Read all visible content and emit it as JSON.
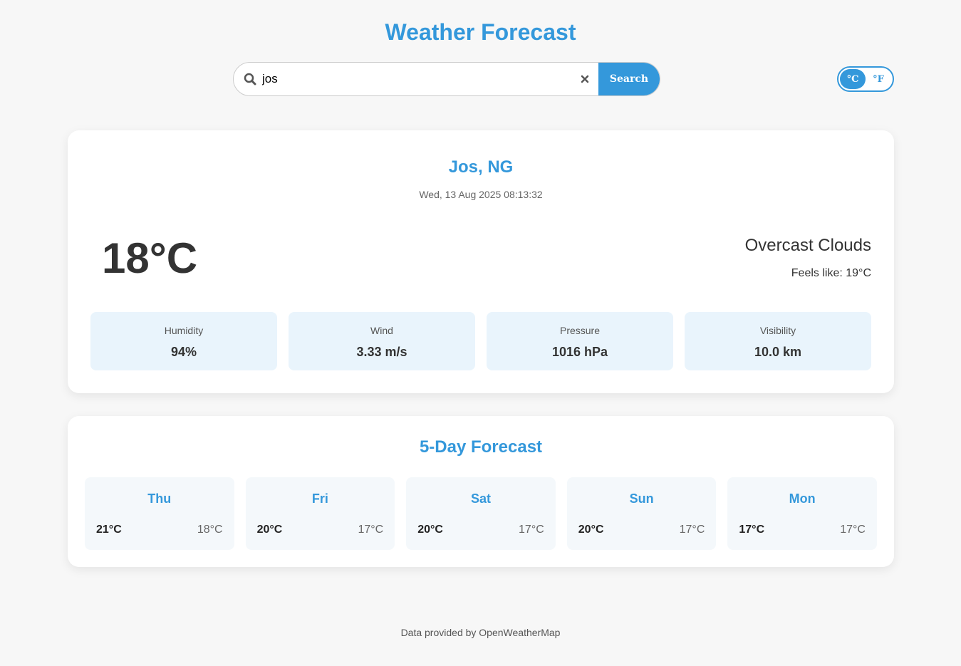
{
  "header": {
    "title": "Weather Forecast"
  },
  "search": {
    "value": "jos",
    "button_label": "Search",
    "clear_symbol": "×"
  },
  "units": {
    "celsius": "°C",
    "fahrenheit": "°F",
    "active": "celsius"
  },
  "current": {
    "location": "Jos, NG",
    "datetime": "Wed, 13 Aug 2025 08:13:32",
    "temperature": "18°C",
    "condition": "Overcast Clouds",
    "feels_like": "Feels like: 19°C",
    "stats": [
      {
        "label": "Humidity",
        "value": "94%"
      },
      {
        "label": "Wind",
        "value": "3.33 m/s"
      },
      {
        "label": "Pressure",
        "value": "1016 hPa"
      },
      {
        "label": "Visibility",
        "value": "10.0 km"
      }
    ]
  },
  "forecast": {
    "title": "5-Day Forecast",
    "days": [
      {
        "day": "Thu",
        "high": "21°C",
        "low": "18°C"
      },
      {
        "day": "Fri",
        "high": "20°C",
        "low": "17°C"
      },
      {
        "day": "Sat",
        "high": "20°C",
        "low": "17°C"
      },
      {
        "day": "Sun",
        "high": "20°C",
        "low": "17°C"
      },
      {
        "day": "Mon",
        "high": "17°C",
        "low": "17°C"
      }
    ]
  },
  "footer": {
    "text": "Data provided by OpenWeatherMap"
  },
  "colors": {
    "accent": "#3498db",
    "stat_bg": "#e9f4fc",
    "day_bg": "#f4f8fb"
  }
}
